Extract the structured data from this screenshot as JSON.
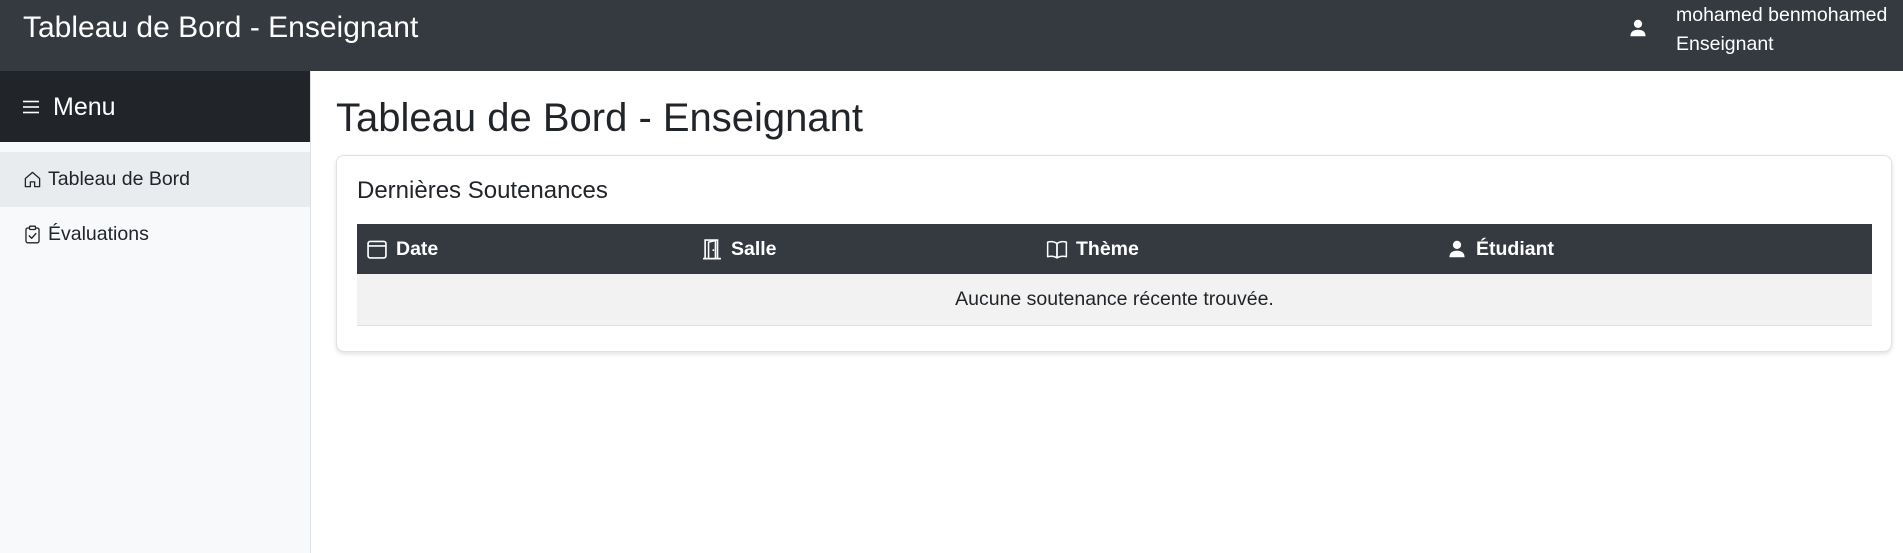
{
  "header": {
    "title": "Tableau de Bord - Enseignant",
    "user": {
      "name": "mohamed benmohamed",
      "role": "Enseignant",
      "icon": "user-icon"
    }
  },
  "sidebar": {
    "title": "Menu",
    "title_icon": "hamburger-icon",
    "items": [
      {
        "label": "Tableau de Bord",
        "icon": "home-icon",
        "active": true
      },
      {
        "label": "Évaluations",
        "icon": "clipboard-check-icon",
        "active": false
      }
    ]
  },
  "main": {
    "page_title": "Tableau de Bord - Enseignant",
    "card": {
      "title": "Dernières Soutenances",
      "columns": [
        {
          "label": "Date",
          "icon": "calendar-icon"
        },
        {
          "label": "Salle",
          "icon": "door-icon"
        },
        {
          "label": "Thème",
          "icon": "book-icon"
        },
        {
          "label": "Étudiant",
          "icon": "user-icon"
        }
      ],
      "empty_message": "Aucune soutenance récente trouvée."
    }
  },
  "colors": {
    "topbar": "#343a40",
    "sidebar_header": "#212529",
    "sidebar_bg": "#f8f9fa",
    "active_item": "#e9ecef",
    "table_header": "#343a40",
    "empty_row": "#f2f2f2"
  }
}
